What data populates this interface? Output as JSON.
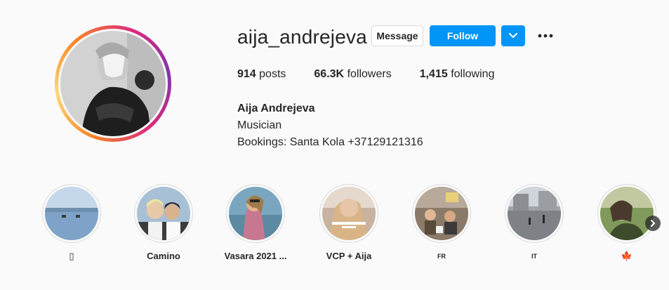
{
  "profile": {
    "username": "aija_andrejeva",
    "message_label": "Message",
    "follow_label": "Follow",
    "avatar_icon": "profile-photo"
  },
  "stats": {
    "posts_count": "914",
    "posts_label": "posts",
    "followers_count": "66.3K",
    "followers_label": "followers",
    "following_count": "1,415",
    "following_label": "following"
  },
  "bio": {
    "full_name": "Aija Andrejeva",
    "category": "Musician",
    "line": "Bookings: Santa Kola +37129121316"
  },
  "highlights": [
    {
      "label": "▯"
    },
    {
      "label": "Camino"
    },
    {
      "label": "Vasara 2021 ..."
    },
    {
      "label": "VCP + Aija"
    },
    {
      "label": "FR"
    },
    {
      "label": "IT"
    },
    {
      "label": "🍁"
    }
  ],
  "colors": {
    "accent": "#0095f6",
    "text": "#262626",
    "border": "#dbdbdb",
    "background": "#fafafa"
  }
}
